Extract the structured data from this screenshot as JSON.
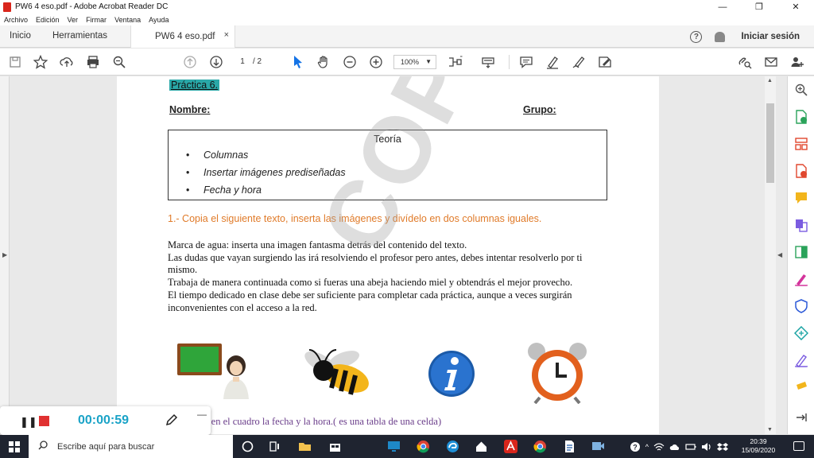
{
  "window": {
    "title": "PW6 4 eso.pdf - Adobe Acrobat Reader DC",
    "minimize": "—",
    "maximize": "❐",
    "close": "✕"
  },
  "menu": [
    "Archivo",
    "Edición",
    "Ver",
    "Firmar",
    "Ventana",
    "Ayuda"
  ],
  "tabs": {
    "home": "Inicio",
    "tools": "Herramientas",
    "doc": "PW6 4 eso.pdf",
    "doc_close": "×",
    "help": "?",
    "signin": "Iniciar sesión"
  },
  "toolbar": {
    "page_current": "1",
    "page_total": "/ 2",
    "zoom": "100%"
  },
  "document": {
    "practica": "Práctica 6.",
    "nombre": "Nombre:",
    "grupo": "Grupo:",
    "teoria_title": "Teoría",
    "teoria_items": [
      "Columnas",
      "Insertar imágenes prediseñadas",
      "Fecha y hora"
    ],
    "exercise1": "1.- Copia el siguiente texto, inserta las imágenes y divídelo en dos columnas iguales.",
    "paragraphs": [
      "Marca de agua: inserta una imagen fantasma detrás del contenido del texto.",
      "Las dudas que vayan surgiendo las irá resolviendo el profesor pero antes, debes intentar resolverlo por ti mismo.",
      "Trabaja de manera continuada como si fueras una abeja haciendo miel y obtendrás el mejor provecho.",
      "El tiempo dedicado en clase debe ser suficiente para completar cada práctica, aunque a veces surgirán inconvenientes con el acceso a la red."
    ],
    "watermark": "COPIAR",
    "exercise2_partial": "a en el cuadro la fecha y la hora.( es una tabla de una celda)"
  },
  "recorder": {
    "pause": "❚❚",
    "time": "00:00:59",
    "minimize": "—"
  },
  "taskbar": {
    "search_placeholder": "Escribe aquí para buscar",
    "time": "20:39",
    "date": "15/09/2020"
  },
  "colors": {
    "acrobat_red": "#d9261c",
    "practica_highlight": "#2aa8a8",
    "exercise_orange": "#e07b2a",
    "recorder_time": "#1aa3c7",
    "taskbar_bg": "#1f2430"
  }
}
